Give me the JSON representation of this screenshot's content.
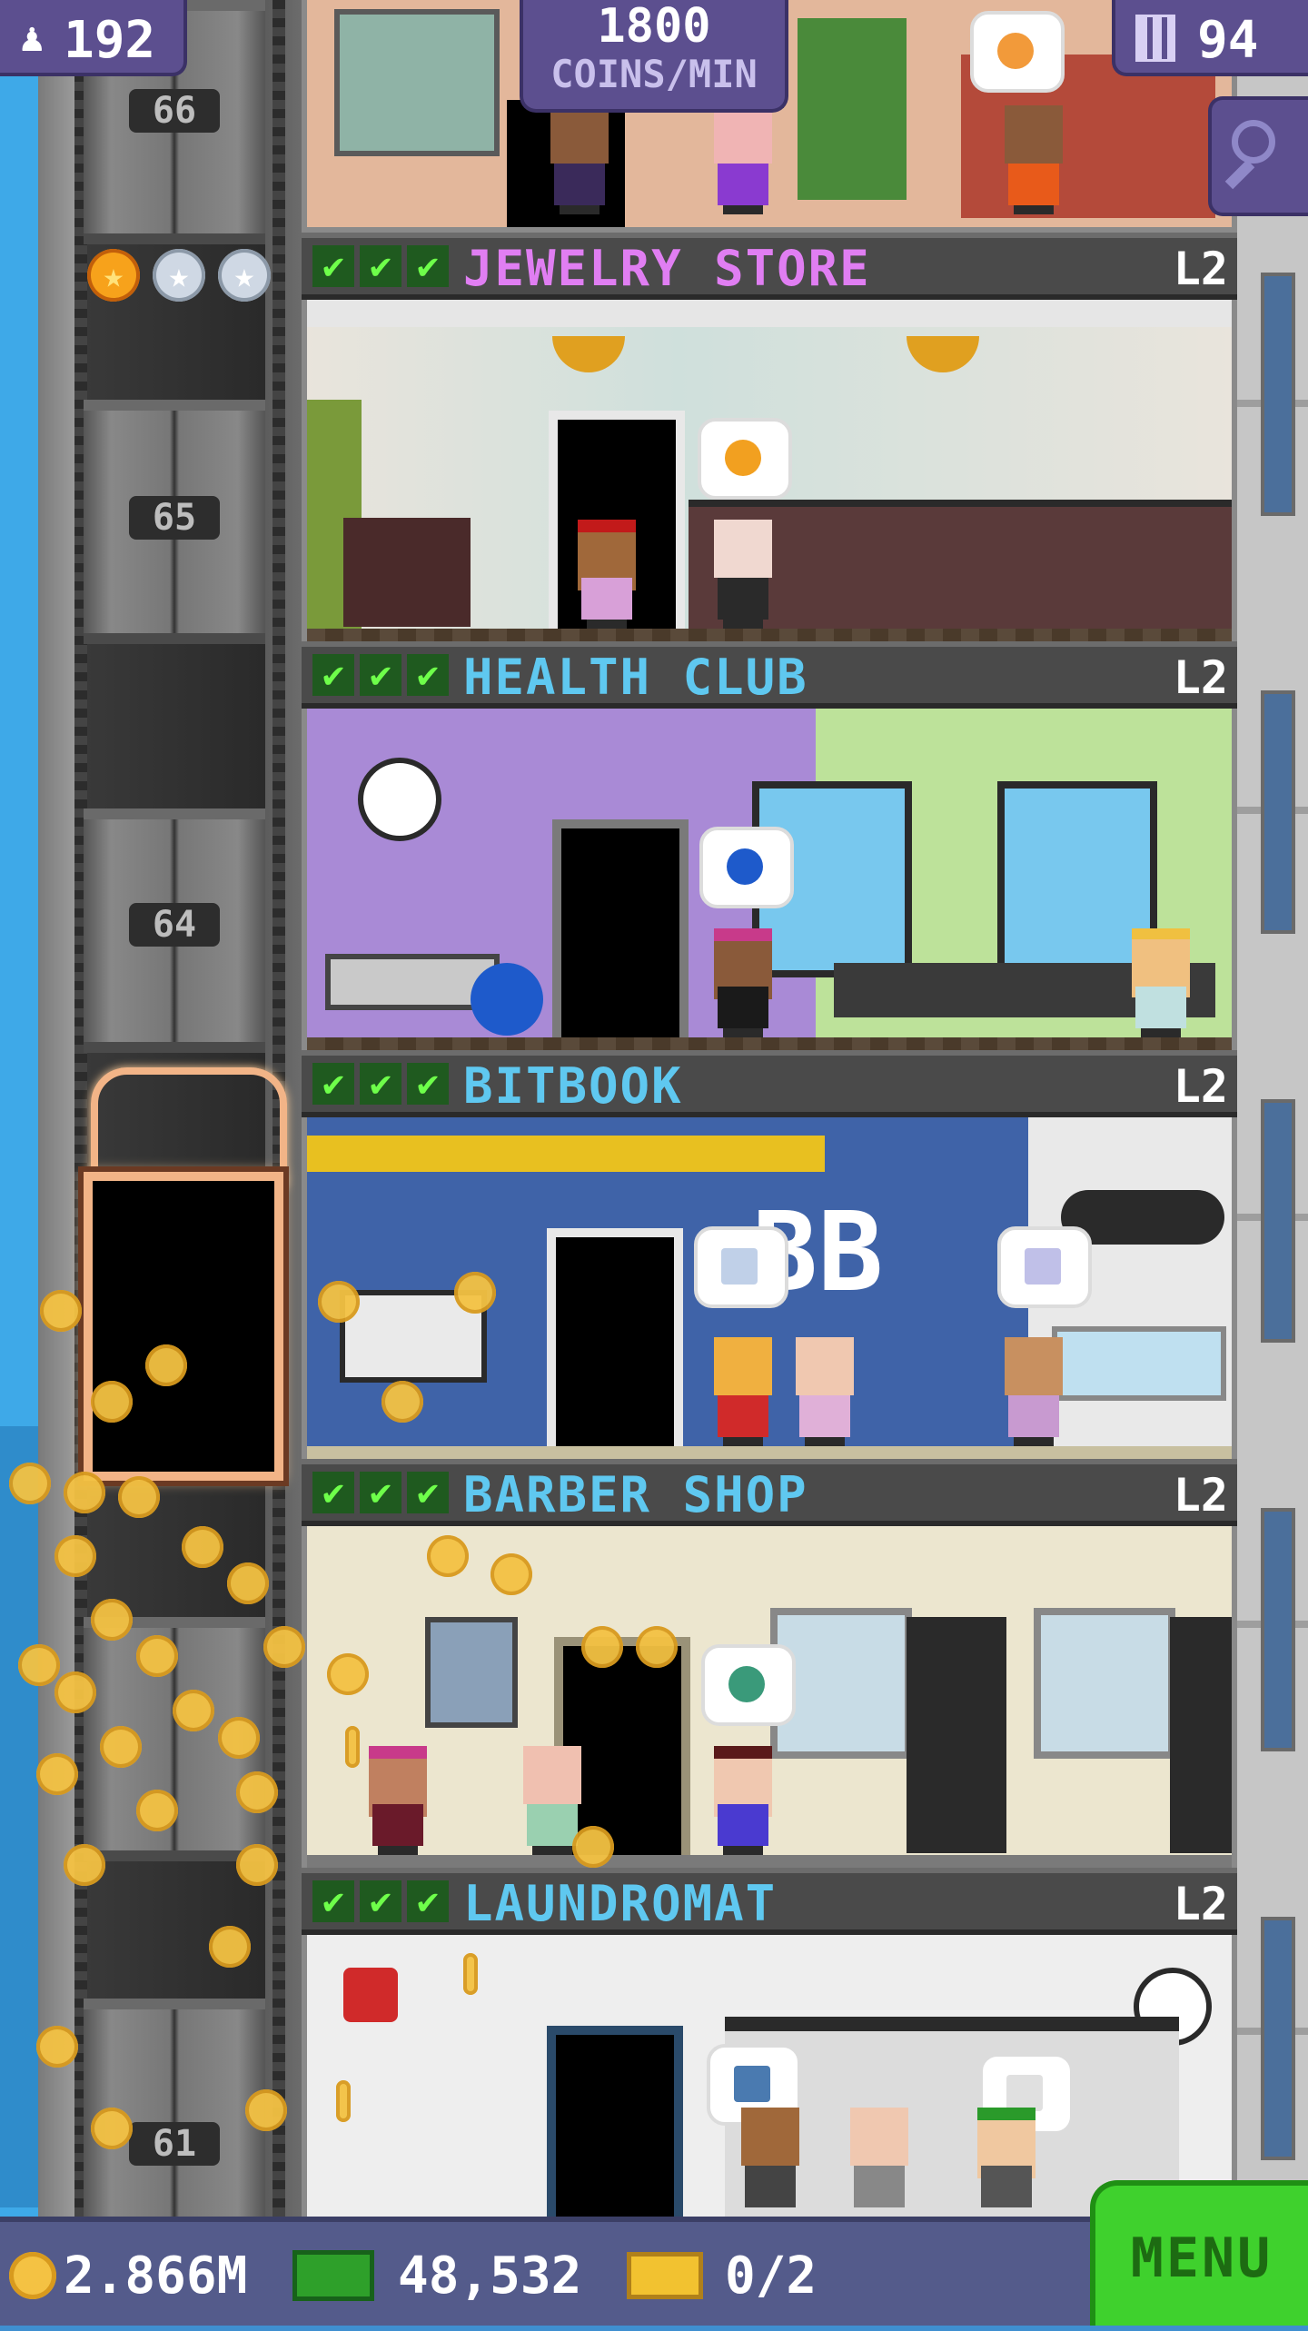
{
  "top_bar": {
    "population": "192",
    "coins_rate_value": "1800",
    "coins_rate_unit": "COINS/MIN",
    "floors_count": "94"
  },
  "elevator": {
    "floor_labels": [
      "66",
      "65",
      "64",
      "61"
    ],
    "stars": {
      "gold": 1,
      "total": 3
    }
  },
  "floors": [
    {
      "name": "JEWELRY STORE",
      "level": "L2",
      "name_color": "#e07ef2"
    },
    {
      "name": "HEALTH CLUB",
      "level": "L2",
      "name_color": "#5fc8f0"
    },
    {
      "name": "BITBOOK",
      "level": "L2",
      "name_color": "#5fc8f0"
    },
    {
      "name": "BARBER SHOP",
      "level": "L2",
      "name_color": "#5fc8f0"
    },
    {
      "name": "LAUNDROMAT",
      "level": "L2",
      "name_color": "#5fc8f0"
    }
  ],
  "bottom_bar": {
    "coins": "2.866M",
    "bux": "48,532",
    "tickets": "0/2",
    "menu_label": "MENU"
  },
  "colors": {
    "menu_green": "#3fd12d",
    "panel_purple": "#5c4f8f",
    "check_green": "#6eff4a",
    "coin_gold": "#f4c243"
  }
}
